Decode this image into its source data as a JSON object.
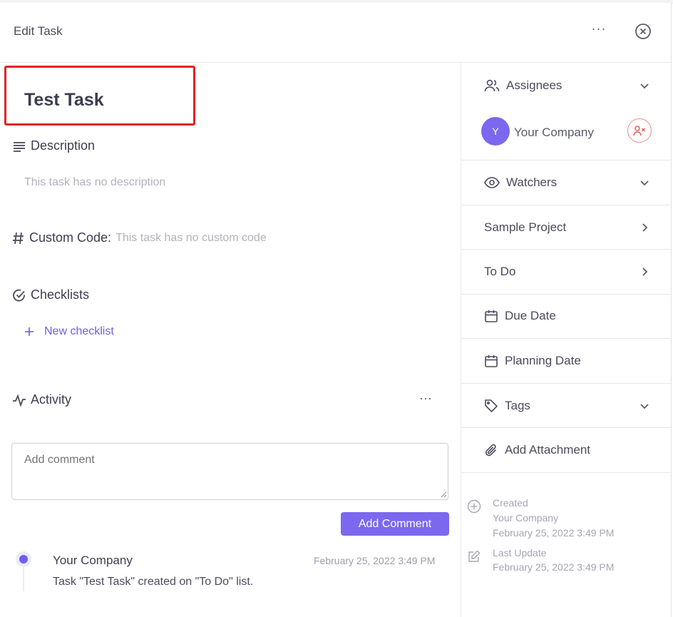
{
  "header": {
    "title": "Edit Task",
    "more_glyph": "···"
  },
  "task": {
    "title": "Test Task"
  },
  "description": {
    "heading": "Description",
    "placeholder": "This task has no description"
  },
  "custom_code": {
    "heading": "Custom Code:",
    "value": "This task has no custom code"
  },
  "checklists": {
    "heading": "Checklists",
    "new_label": "New checklist"
  },
  "activity": {
    "heading": "Activity",
    "comment_placeholder": "Add comment",
    "add_button": "Add Comment",
    "entries": [
      {
        "author": "Your Company",
        "date": "February 25, 2022 3:49 PM",
        "message": "Task \"Test Task\" created on \"To Do\" list."
      }
    ]
  },
  "sidebar": {
    "assignees": {
      "label": "Assignees",
      "avatar_initial": "Y",
      "name": "Your Company"
    },
    "watchers": {
      "label": "Watchers"
    },
    "project": {
      "label": "Sample Project"
    },
    "list": {
      "label": "To Do"
    },
    "due_date": {
      "label": "Due Date"
    },
    "planning_date": {
      "label": "Planning Date"
    },
    "tags": {
      "label": "Tags"
    },
    "attachment": {
      "label": "Add Attachment"
    },
    "created": {
      "label": "Created",
      "by": "Your Company",
      "date": "February 25, 2022 3:49 PM"
    },
    "updated": {
      "label": "Last Update",
      "date": "February 25, 2022 3:49 PM"
    }
  },
  "colors": {
    "accent": "#7b68ee",
    "highlight_border": "#e02424",
    "remove_red": "#f08a8a"
  },
  "icons": [
    "close-icon",
    "more-icon",
    "description-icon",
    "hash-icon",
    "check-circle-icon",
    "plus-icon",
    "activity-icon",
    "users-icon",
    "eye-icon",
    "chevron-down-icon",
    "chevron-right-icon",
    "calendar-icon",
    "tag-icon",
    "paperclip-icon",
    "plus-circle-icon",
    "edit-icon",
    "user-remove-icon"
  ]
}
